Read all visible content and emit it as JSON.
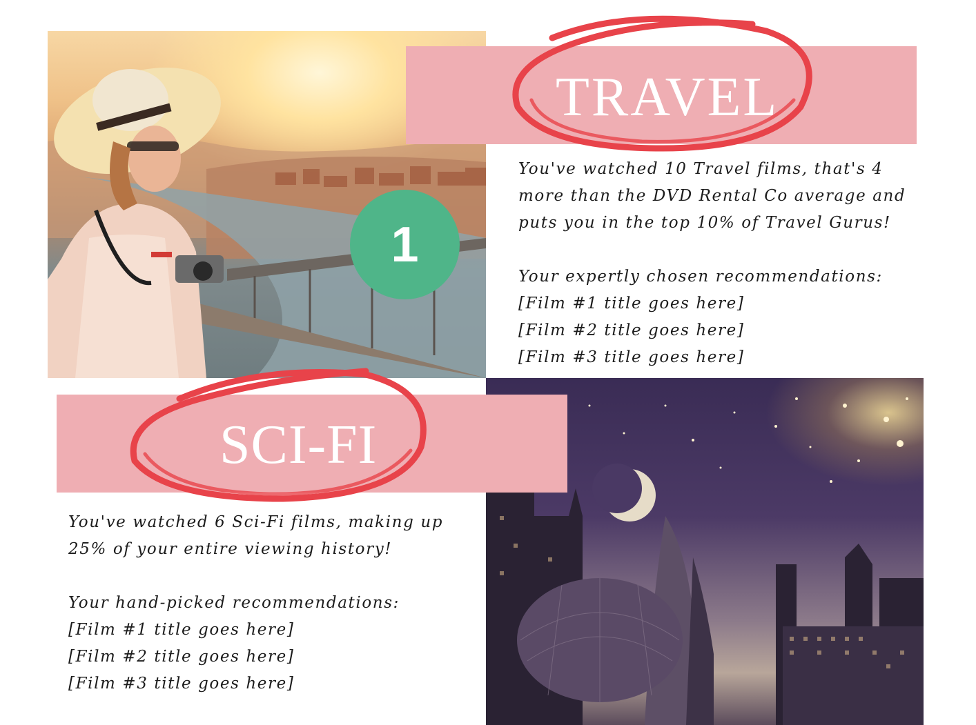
{
  "travel": {
    "title": "TRAVEL",
    "badge": "1",
    "stats_lines": [
      "You've watched 10 Travel films, that's 4",
      "more than the DVD Rental Co average and",
      "puts you in the top 10% of Travel Gurus!"
    ],
    "recommendations_heading": "Your expertly chosen recommendations:",
    "recommendations": [
      "[Film #1 title goes here]",
      "[Film #2 title goes here]",
      "[Film #3 title goes here]"
    ]
  },
  "scifi": {
    "title": "SCI-FI",
    "stats_lines": [
      "You've watched 6 Sci-Fi films, making up",
      "25% of your entire viewing history!"
    ],
    "recommendations_heading": "Your hand-picked recommendations:",
    "recommendations": [
      "[Film #1 title goes here]",
      "[Film #2 title goes here]",
      "[Film #3 title goes here]"
    ]
  },
  "colors": {
    "banner_pink": "#efaeb3",
    "scribble_red": "#e8434a",
    "badge_green": "#4fb589",
    "text": "#1c1c1c"
  },
  "icons": {
    "travel_photo": "woman-with-camera-photo",
    "scifi_photo": "futuristic-city-night-photo"
  }
}
